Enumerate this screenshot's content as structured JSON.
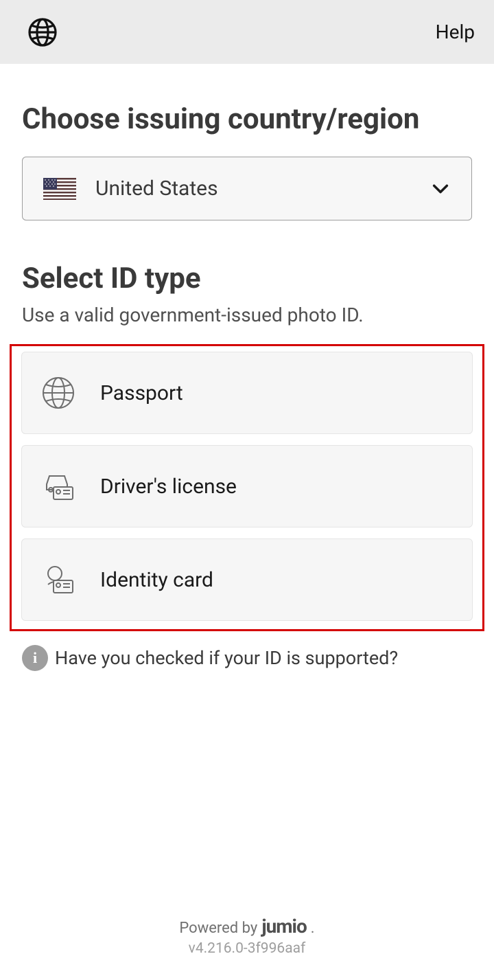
{
  "header": {
    "help_label": "Help"
  },
  "country_section": {
    "title": "Choose issuing country/region",
    "selected_country": "United States"
  },
  "id_section": {
    "title": "Select ID type",
    "subtext": "Use a valid government-issued photo ID.",
    "options": [
      {
        "label": "Passport"
      },
      {
        "label": "Driver's license"
      },
      {
        "label": "Identity card"
      }
    ]
  },
  "supported": {
    "text": "Have you checked if your ID is supported?"
  },
  "footer": {
    "powered_by": "Powered by",
    "brand": "jumio",
    "version": "v4.216.0-3f996aaf"
  }
}
